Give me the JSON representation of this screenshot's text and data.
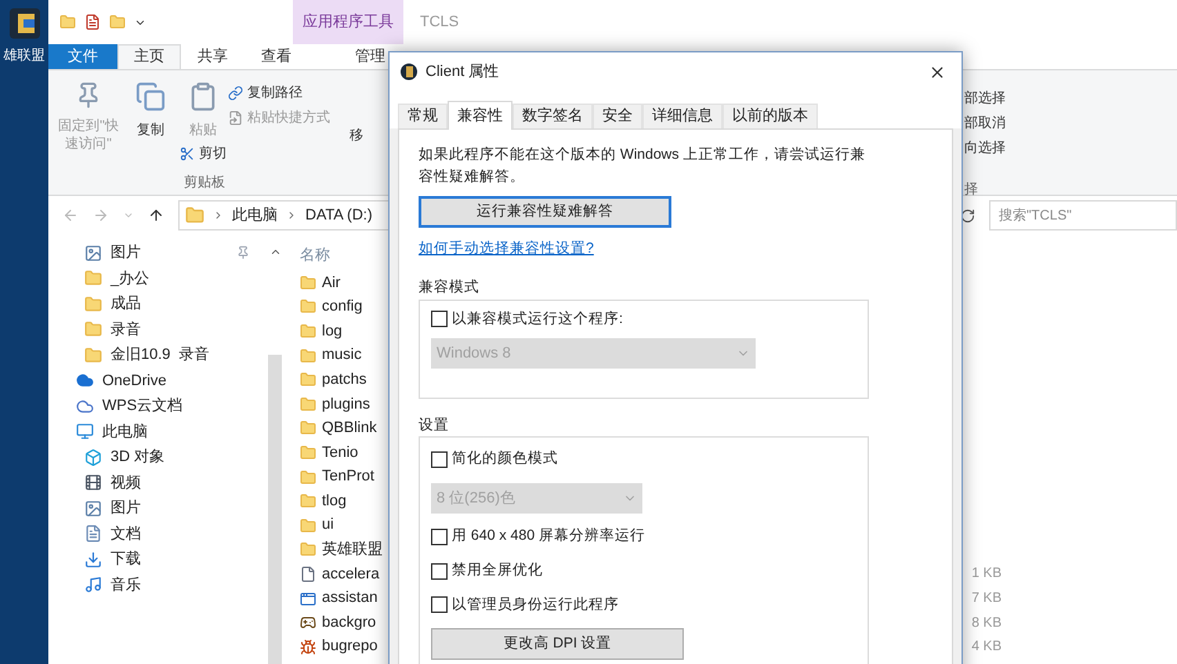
{
  "desktop_icon": {
    "label": "雄联盟"
  },
  "explorer": {
    "title": "TCLS",
    "context_tab": "应用程序工具",
    "ribbon_tabs": [
      {
        "label": "文件",
        "kind": "file",
        "selected": false
      },
      {
        "label": "主页",
        "kind": "tab",
        "selected": true
      },
      {
        "label": "共享",
        "kind": "tab",
        "selected": false
      },
      {
        "label": "查看",
        "kind": "tab",
        "selected": false
      },
      {
        "label": "管理",
        "kind": "tab",
        "selected": false
      }
    ],
    "ribbon": {
      "pin": "固定到\"快速访问\"",
      "copy": "复制",
      "paste": "粘贴",
      "copy_path": "复制路径",
      "paste_shortcut": "粘贴快捷方式",
      "cut": "剪切",
      "group": "剪贴板",
      "move_partial": "移",
      "select_items": [
        "部选择",
        "部取消",
        "向选择"
      ],
      "select_group": "择"
    },
    "address": {
      "path": [
        "此电脑",
        "DATA (D:)"
      ],
      "search_placeholder": "搜索\"TCLS\""
    },
    "nav": [
      {
        "label": "图片",
        "kind": "picture",
        "pinned": true
      },
      {
        "label": "_办公",
        "kind": "folder",
        "pinned": false
      },
      {
        "label": "成品",
        "kind": "folder",
        "pinned": false
      },
      {
        "label": "录音",
        "kind": "folder",
        "pinned": false
      },
      {
        "label": "金旧10.9  录音",
        "kind": "folder",
        "pinned": false
      },
      {
        "label": "OneDrive",
        "kind": "cloud",
        "pinned": false
      },
      {
        "label": "WPS云文档",
        "kind": "wps",
        "pinned": false
      },
      {
        "label": "此电脑",
        "kind": "pc",
        "pinned": false,
        "children": [
          {
            "label": "3D 对象",
            "kind": "cube",
            "pinned": false
          },
          {
            "label": "视频",
            "kind": "video",
            "pinned": false
          },
          {
            "label": "图片",
            "kind": "picture",
            "pinned": false
          },
          {
            "label": "文档",
            "kind": "document",
            "pinned": false
          },
          {
            "label": "下载",
            "kind": "download",
            "pinned": false
          },
          {
            "label": "音乐",
            "kind": "music",
            "pinned": false
          }
        ]
      }
    ],
    "column_header": "名称",
    "files": [
      {
        "name": "Air",
        "kind": "folder"
      },
      {
        "name": "config",
        "kind": "folder"
      },
      {
        "name": "log",
        "kind": "folder"
      },
      {
        "name": "music",
        "kind": "folder"
      },
      {
        "name": "patchs",
        "kind": "folder"
      },
      {
        "name": "plugins",
        "kind": "folder"
      },
      {
        "name": "QBBlink",
        "kind": "folder"
      },
      {
        "name": "Tenio",
        "kind": "folder"
      },
      {
        "name": "TenProt",
        "kind": "folder"
      },
      {
        "name": "tlog",
        "kind": "folder"
      },
      {
        "name": "ui",
        "kind": "folder"
      },
      {
        "name": "英雄联盟",
        "kind": "folder"
      },
      {
        "name": "accelera",
        "kind": "file",
        "size": "1 KB"
      },
      {
        "name": "assistan",
        "kind": "app",
        "size": "7 KB"
      },
      {
        "name": "backgro",
        "kind": "game",
        "size": "8 KB"
      },
      {
        "name": "bugrepo",
        "kind": "bug",
        "size": "4 KB"
      }
    ]
  },
  "dialog": {
    "title": "Client 属性",
    "tabs": [
      {
        "label": "常规",
        "selected": false
      },
      {
        "label": "兼容性",
        "selected": true
      },
      {
        "label": "数字签名",
        "selected": false
      },
      {
        "label": "安全",
        "selected": false
      },
      {
        "label": "详细信息",
        "selected": false
      },
      {
        "label": "以前的版本",
        "selected": false
      }
    ],
    "intro": "如果此程序不能在这个版本的 Windows 上正常工作，请尝试运行兼容性疑难解答。",
    "troubleshoot_button": "运行兼容性疑难解答",
    "help_link": "如何手动选择兼容性设置?",
    "compat_group": {
      "title": "兼容模式",
      "checkbox": {
        "label": "以兼容模式运行这个程序:",
        "checked": false
      },
      "dropdown": {
        "value": "Windows 8",
        "disabled": true
      }
    },
    "settings_group": {
      "title": "设置",
      "items": [
        {
          "kind": "checkbox",
          "label": "简化的颜色模式",
          "checked": false
        },
        {
          "kind": "dropdown",
          "value": "8 位(256)色",
          "disabled": true
        },
        {
          "kind": "checkbox",
          "label": "用 640 x 480 屏幕分辨率运行",
          "checked": false
        },
        {
          "kind": "checkbox",
          "label": "禁用全屏优化",
          "checked": false
        },
        {
          "kind": "checkbox",
          "label": "以管理员身份运行此程序",
          "checked": false
        },
        {
          "kind": "button",
          "label": "更改高 DPI 设置"
        }
      ]
    }
  }
}
